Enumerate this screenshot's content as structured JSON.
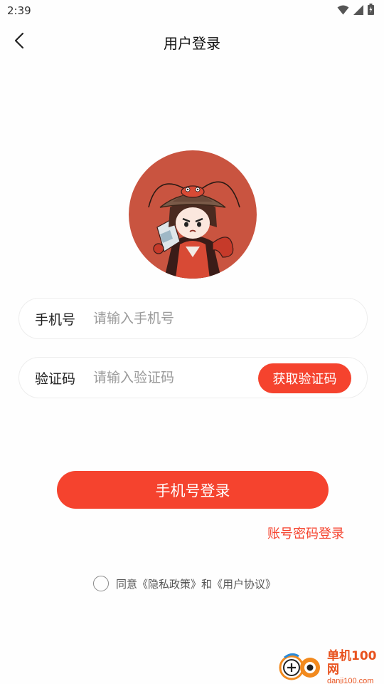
{
  "status_bar": {
    "time": "2:39"
  },
  "header": {
    "title": "用户登录"
  },
  "form": {
    "phone": {
      "label": "手机号",
      "placeholder": "请输入手机号",
      "value": ""
    },
    "code": {
      "label": "验证码",
      "placeholder": "请输入验证码",
      "value": "",
      "button_label": "获取验证码"
    }
  },
  "actions": {
    "login_label": "手机号登录",
    "alt_login_label": "账号密码登录"
  },
  "agreement": {
    "text": "同意《隐私政策》和《用户协议》",
    "checked": false
  },
  "watermark": {
    "title": "单机100网",
    "url": "danji100.com"
  },
  "colors": {
    "accent": "#f5432e",
    "avatar_bg": "#c95440"
  }
}
